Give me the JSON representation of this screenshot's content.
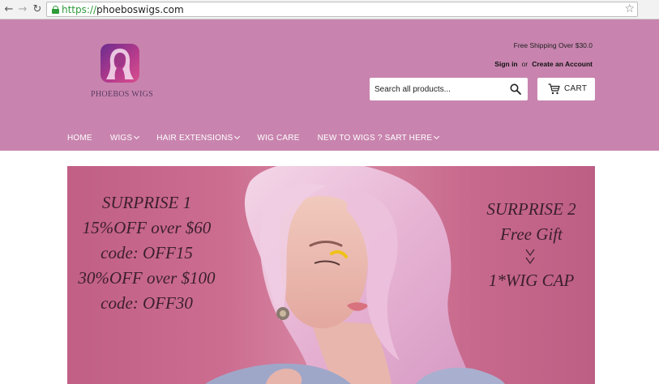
{
  "browser": {
    "back_icon": "back-arrow-icon",
    "forward_icon": "forward-arrow-icon",
    "reload_icon": "reload-icon",
    "url_scheme": "https://",
    "url_host": "phoeboswigs.com",
    "secure_color": "#2e9b3a"
  },
  "header": {
    "background": "#c884ae",
    "logo_text": "PHOEBOS WIGS",
    "shipping_note": "Free Shipping Over $30.0",
    "sign_in": "Sign in",
    "or": "or",
    "create_account": "Create an Account",
    "search_placeholder": "Search all products...",
    "cart_label": "CART"
  },
  "nav": {
    "items": [
      {
        "label": "HOME",
        "dropdown": false
      },
      {
        "label": "WIGS",
        "dropdown": true
      },
      {
        "label": "HAIR EXTENSIONS",
        "dropdown": true
      },
      {
        "label": "WIG CARE",
        "dropdown": false
      },
      {
        "label": "NEW TO WIGS ? SART HERE",
        "dropdown": true
      }
    ]
  },
  "hero": {
    "left_lines": [
      "SURPRISE 1",
      "15%OFF over  $60",
      "code: OFF15",
      "30%OFF over  $100",
      "code: OFF30"
    ],
    "right_title": "SURPRISE 2",
    "right_subtitle": "Free Gift",
    "right_item": "1*WIG CAP"
  }
}
